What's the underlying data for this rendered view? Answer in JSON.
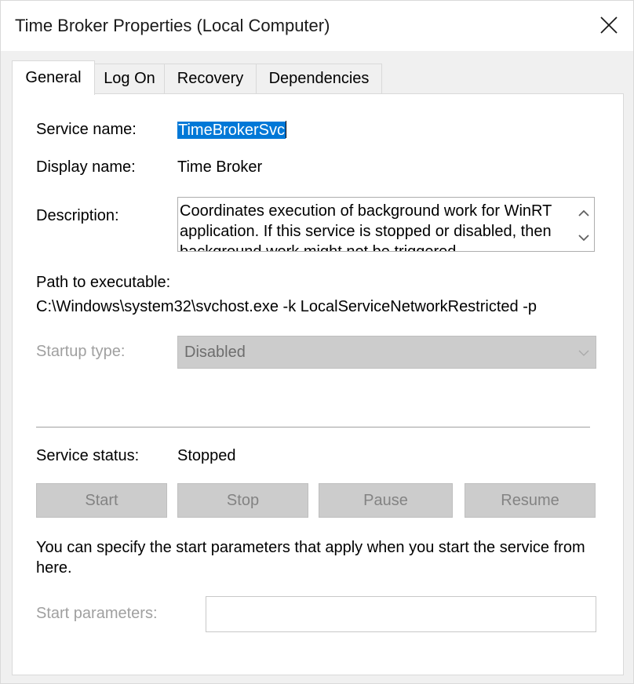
{
  "window": {
    "title": "Time Broker Properties (Local Computer)",
    "close_label": "close"
  },
  "tabs": [
    {
      "label": "General",
      "active": true
    },
    {
      "label": "Log On",
      "active": false
    },
    {
      "label": "Recovery",
      "active": false
    },
    {
      "label": "Dependencies",
      "active": false
    }
  ],
  "general": {
    "service_name_label": "Service name:",
    "service_name_value": "TimeBrokerSvc",
    "display_name_label": "Display name:",
    "display_name_value": "Time Broker",
    "description_label": "Description:",
    "description_value": "Coordinates execution of background work for WinRT application. If this service is stopped or disabled, then background work might not be triggered.",
    "path_label": "Path to executable:",
    "path_value": "C:\\Windows\\system32\\svchost.exe -k LocalServiceNetworkRestricted -p",
    "startup_type_label": "Startup type:",
    "startup_type_value": "Disabled",
    "service_status_label": "Service status:",
    "service_status_value": "Stopped",
    "buttons": {
      "start": "Start",
      "stop": "Stop",
      "pause": "Pause",
      "resume": "Resume"
    },
    "info_text": "You can specify the start parameters that apply when you start the service from here.",
    "start_parameters_label": "Start parameters:",
    "start_parameters_value": ""
  },
  "icons": {
    "close": "close-icon",
    "scroll_up": "chevron-up-icon",
    "scroll_down": "chevron-down-icon",
    "combo_arrow": "chevron-down-icon"
  }
}
